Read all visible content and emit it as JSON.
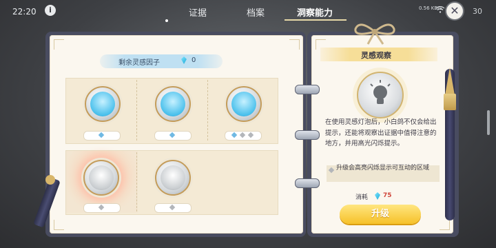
{
  "status": {
    "time": "22:20",
    "speed": "0.56\nKB/S",
    "battery": "30"
  },
  "tabs": [
    {
      "label": "证据",
      "active": false
    },
    {
      "label": "档案",
      "active": false
    },
    {
      "label": "洞察能力",
      "active": true
    }
  ],
  "factor": {
    "label": "剩余灵感因子",
    "count": "0"
  },
  "skills": [
    {
      "name": "skill-1",
      "level_pips": 1,
      "style": "blue"
    },
    {
      "name": "skill-2",
      "level_pips": 1,
      "style": "blue"
    },
    {
      "name": "skill-3",
      "level_pips": 3,
      "style": "blue"
    },
    {
      "name": "skill-4",
      "level_pips": 1,
      "style": "grey",
      "selected": true
    },
    {
      "name": "skill-5",
      "level_pips": 1,
      "style": "grey"
    }
  ],
  "detail": {
    "title": "灵感观察",
    "description": "在使用灵感灯泡后，小白鸽不仅会给出提示，还能将观察出证据中值得注意的地方，并用高光闪烁提示。",
    "upgrade_effect": "升级会高亮闪烁显示可互动的区域",
    "cost_label": "消耗",
    "cost_value": "75",
    "upgrade_button": "升级"
  },
  "colors": {
    "accent_gold": "#f6c129",
    "cost_red": "#d0473c",
    "gem_blue": "#1fa9d8"
  }
}
